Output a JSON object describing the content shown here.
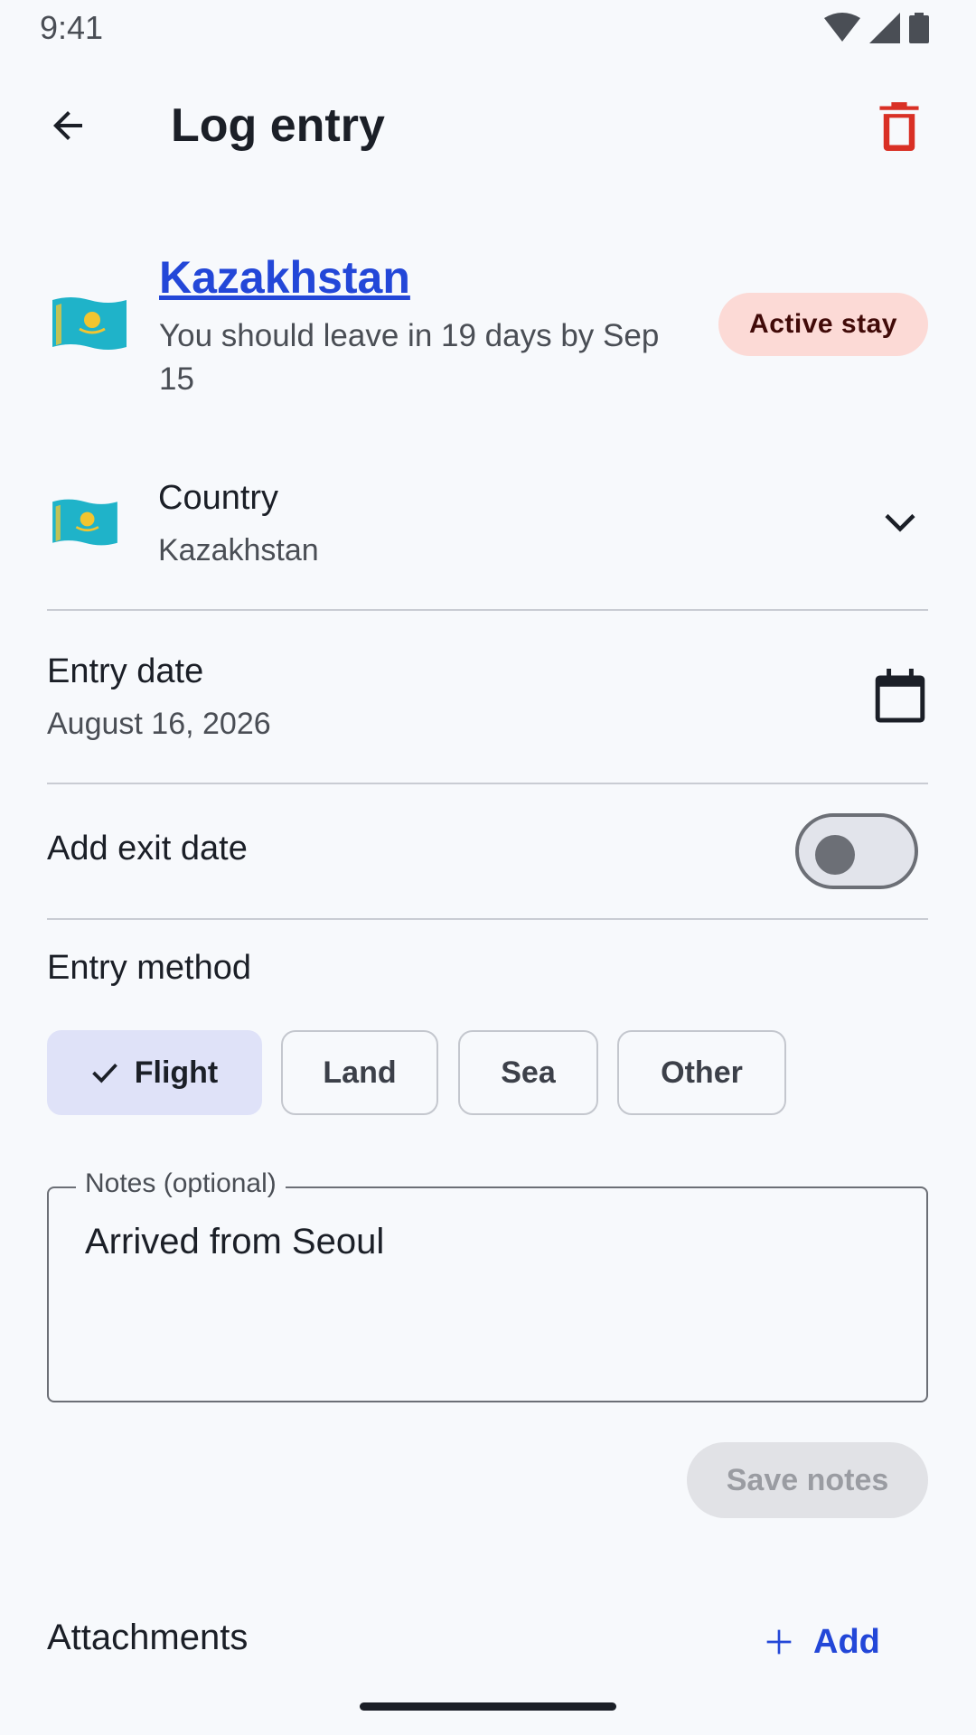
{
  "status_bar": {
    "time": "9:41"
  },
  "app_bar": {
    "title": "Log entry"
  },
  "header": {
    "country": "Kazakhstan",
    "subtitle": "You should leave in 19 days by Sep 15",
    "badge": "Active stay",
    "badge_color": "#fcdad6"
  },
  "country_field": {
    "label": "Country",
    "value": "Kazakhstan"
  },
  "entry_date": {
    "label": "Entry date",
    "value": "August 16, 2026"
  },
  "exit_date": {
    "label": "Add exit date",
    "enabled": false
  },
  "entry_method": {
    "label": "Entry method",
    "options": [
      "Flight",
      "Land",
      "Sea",
      "Other"
    ],
    "selected": "Flight"
  },
  "notes": {
    "label": "Notes (optional)",
    "value": "Arrived from Seoul",
    "save_label": "Save notes"
  },
  "attachments": {
    "title": "Attachments",
    "add_label": "Add"
  },
  "colors": {
    "accent": "#2347d8",
    "delete": "#d93025",
    "chip_selected": "#dfe2f8"
  }
}
